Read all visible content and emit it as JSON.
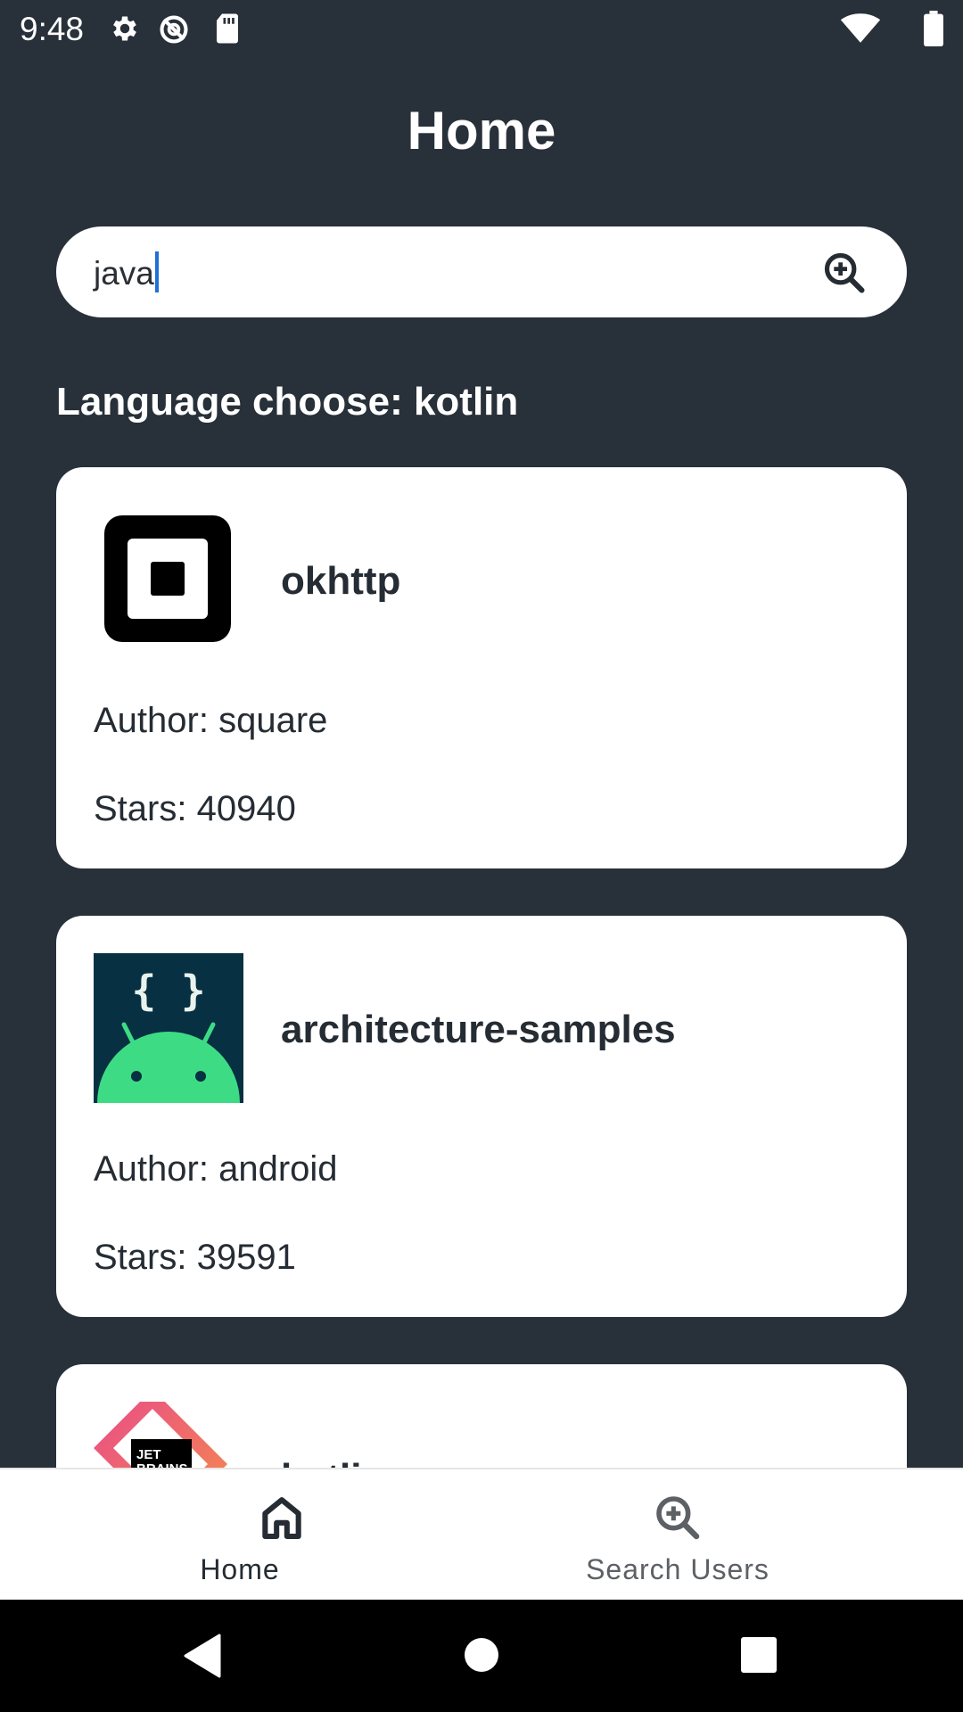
{
  "status_bar": {
    "time": "9:48",
    "icons": [
      "gear-icon",
      "sync-off-icon",
      "sd-card-icon",
      "wifi-icon",
      "battery-icon"
    ]
  },
  "page": {
    "title": "Home"
  },
  "search": {
    "value": "java",
    "icon": "search-plus-icon"
  },
  "section": {
    "heading": "Language choose: kotlin"
  },
  "repos": [
    {
      "name": "okhttp",
      "author": "Author: square",
      "stars": "Stars: 40940",
      "avatar": "square-logo"
    },
    {
      "name": "architecture-samples",
      "author": "Author: android",
      "stars": "Stars: 39591",
      "avatar": "android-logo"
    },
    {
      "name": "kotlin",
      "author": "",
      "stars": "",
      "avatar": "jetbrains-logo"
    }
  ],
  "bottom_nav": {
    "items": [
      {
        "label": "Home",
        "icon": "home-icon",
        "selected": true
      },
      {
        "label": "Search Users",
        "icon": "search-plus-icon",
        "selected": false
      }
    ]
  },
  "colors": {
    "background": "#28313a",
    "card": "#ffffff",
    "text_dark": "#252c33",
    "nav_inactive": "#5d6166",
    "android_green": "#3ddc84",
    "android_bg": "#073042"
  }
}
